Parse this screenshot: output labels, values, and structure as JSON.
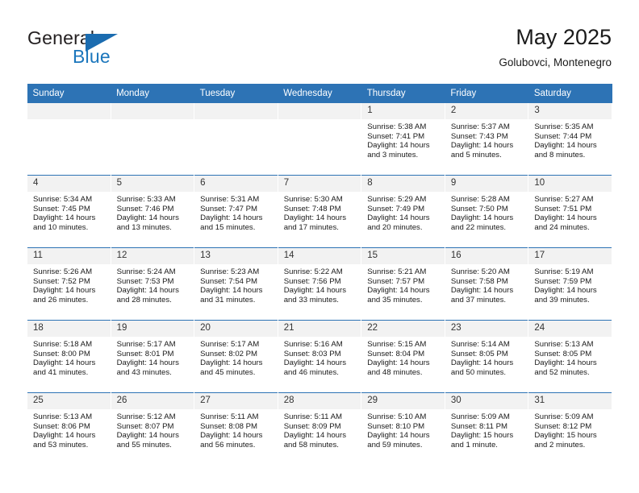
{
  "brand": {
    "word1": "General",
    "word2": "Blue",
    "accent_color": "#1b76bc",
    "triangle_color": "#1b6cb0"
  },
  "header": {
    "title": "May 2025",
    "subtitle": "Golubovci, Montenegro"
  },
  "theme": {
    "header_bg": "#2d73b5",
    "daynum_bg": "#f2f2f2",
    "cell_bg": "#ffffff",
    "text_color": "#1a1a1a"
  },
  "weekdays": [
    "Sunday",
    "Monday",
    "Tuesday",
    "Wednesday",
    "Thursday",
    "Friday",
    "Saturday"
  ],
  "weeks": [
    [
      {
        "day": "",
        "lines": []
      },
      {
        "day": "",
        "lines": []
      },
      {
        "day": "",
        "lines": []
      },
      {
        "day": "",
        "lines": []
      },
      {
        "day": "1",
        "lines": [
          "Sunrise: 5:38 AM",
          "Sunset: 7:41 PM",
          "Daylight: 14 hours",
          "and 3 minutes."
        ]
      },
      {
        "day": "2",
        "lines": [
          "Sunrise: 5:37 AM",
          "Sunset: 7:43 PM",
          "Daylight: 14 hours",
          "and 5 minutes."
        ]
      },
      {
        "day": "3",
        "lines": [
          "Sunrise: 5:35 AM",
          "Sunset: 7:44 PM",
          "Daylight: 14 hours",
          "and 8 minutes."
        ]
      }
    ],
    [
      {
        "day": "4",
        "lines": [
          "Sunrise: 5:34 AM",
          "Sunset: 7:45 PM",
          "Daylight: 14 hours",
          "and 10 minutes."
        ]
      },
      {
        "day": "5",
        "lines": [
          "Sunrise: 5:33 AM",
          "Sunset: 7:46 PM",
          "Daylight: 14 hours",
          "and 13 minutes."
        ]
      },
      {
        "day": "6",
        "lines": [
          "Sunrise: 5:31 AM",
          "Sunset: 7:47 PM",
          "Daylight: 14 hours",
          "and 15 minutes."
        ]
      },
      {
        "day": "7",
        "lines": [
          "Sunrise: 5:30 AM",
          "Sunset: 7:48 PM",
          "Daylight: 14 hours",
          "and 17 minutes."
        ]
      },
      {
        "day": "8",
        "lines": [
          "Sunrise: 5:29 AM",
          "Sunset: 7:49 PM",
          "Daylight: 14 hours",
          "and 20 minutes."
        ]
      },
      {
        "day": "9",
        "lines": [
          "Sunrise: 5:28 AM",
          "Sunset: 7:50 PM",
          "Daylight: 14 hours",
          "and 22 minutes."
        ]
      },
      {
        "day": "10",
        "lines": [
          "Sunrise: 5:27 AM",
          "Sunset: 7:51 PM",
          "Daylight: 14 hours",
          "and 24 minutes."
        ]
      }
    ],
    [
      {
        "day": "11",
        "lines": [
          "Sunrise: 5:26 AM",
          "Sunset: 7:52 PM",
          "Daylight: 14 hours",
          "and 26 minutes."
        ]
      },
      {
        "day": "12",
        "lines": [
          "Sunrise: 5:24 AM",
          "Sunset: 7:53 PM",
          "Daylight: 14 hours",
          "and 28 minutes."
        ]
      },
      {
        "day": "13",
        "lines": [
          "Sunrise: 5:23 AM",
          "Sunset: 7:54 PM",
          "Daylight: 14 hours",
          "and 31 minutes."
        ]
      },
      {
        "day": "14",
        "lines": [
          "Sunrise: 5:22 AM",
          "Sunset: 7:56 PM",
          "Daylight: 14 hours",
          "and 33 minutes."
        ]
      },
      {
        "day": "15",
        "lines": [
          "Sunrise: 5:21 AM",
          "Sunset: 7:57 PM",
          "Daylight: 14 hours",
          "and 35 minutes."
        ]
      },
      {
        "day": "16",
        "lines": [
          "Sunrise: 5:20 AM",
          "Sunset: 7:58 PM",
          "Daylight: 14 hours",
          "and 37 minutes."
        ]
      },
      {
        "day": "17",
        "lines": [
          "Sunrise: 5:19 AM",
          "Sunset: 7:59 PM",
          "Daylight: 14 hours",
          "and 39 minutes."
        ]
      }
    ],
    [
      {
        "day": "18",
        "lines": [
          "Sunrise: 5:18 AM",
          "Sunset: 8:00 PM",
          "Daylight: 14 hours",
          "and 41 minutes."
        ]
      },
      {
        "day": "19",
        "lines": [
          "Sunrise: 5:17 AM",
          "Sunset: 8:01 PM",
          "Daylight: 14 hours",
          "and 43 minutes."
        ]
      },
      {
        "day": "20",
        "lines": [
          "Sunrise: 5:17 AM",
          "Sunset: 8:02 PM",
          "Daylight: 14 hours",
          "and 45 minutes."
        ]
      },
      {
        "day": "21",
        "lines": [
          "Sunrise: 5:16 AM",
          "Sunset: 8:03 PM",
          "Daylight: 14 hours",
          "and 46 minutes."
        ]
      },
      {
        "day": "22",
        "lines": [
          "Sunrise: 5:15 AM",
          "Sunset: 8:04 PM",
          "Daylight: 14 hours",
          "and 48 minutes."
        ]
      },
      {
        "day": "23",
        "lines": [
          "Sunrise: 5:14 AM",
          "Sunset: 8:05 PM",
          "Daylight: 14 hours",
          "and 50 minutes."
        ]
      },
      {
        "day": "24",
        "lines": [
          "Sunrise: 5:13 AM",
          "Sunset: 8:05 PM",
          "Daylight: 14 hours",
          "and 52 minutes."
        ]
      }
    ],
    [
      {
        "day": "25",
        "lines": [
          "Sunrise: 5:13 AM",
          "Sunset: 8:06 PM",
          "Daylight: 14 hours",
          "and 53 minutes."
        ]
      },
      {
        "day": "26",
        "lines": [
          "Sunrise: 5:12 AM",
          "Sunset: 8:07 PM",
          "Daylight: 14 hours",
          "and 55 minutes."
        ]
      },
      {
        "day": "27",
        "lines": [
          "Sunrise: 5:11 AM",
          "Sunset: 8:08 PM",
          "Daylight: 14 hours",
          "and 56 minutes."
        ]
      },
      {
        "day": "28",
        "lines": [
          "Sunrise: 5:11 AM",
          "Sunset: 8:09 PM",
          "Daylight: 14 hours",
          "and 58 minutes."
        ]
      },
      {
        "day": "29",
        "lines": [
          "Sunrise: 5:10 AM",
          "Sunset: 8:10 PM",
          "Daylight: 14 hours",
          "and 59 minutes."
        ]
      },
      {
        "day": "30",
        "lines": [
          "Sunrise: 5:09 AM",
          "Sunset: 8:11 PM",
          "Daylight: 15 hours",
          "and 1 minute."
        ]
      },
      {
        "day": "31",
        "lines": [
          "Sunrise: 5:09 AM",
          "Sunset: 8:12 PM",
          "Daylight: 15 hours",
          "and 2 minutes."
        ]
      }
    ]
  ]
}
